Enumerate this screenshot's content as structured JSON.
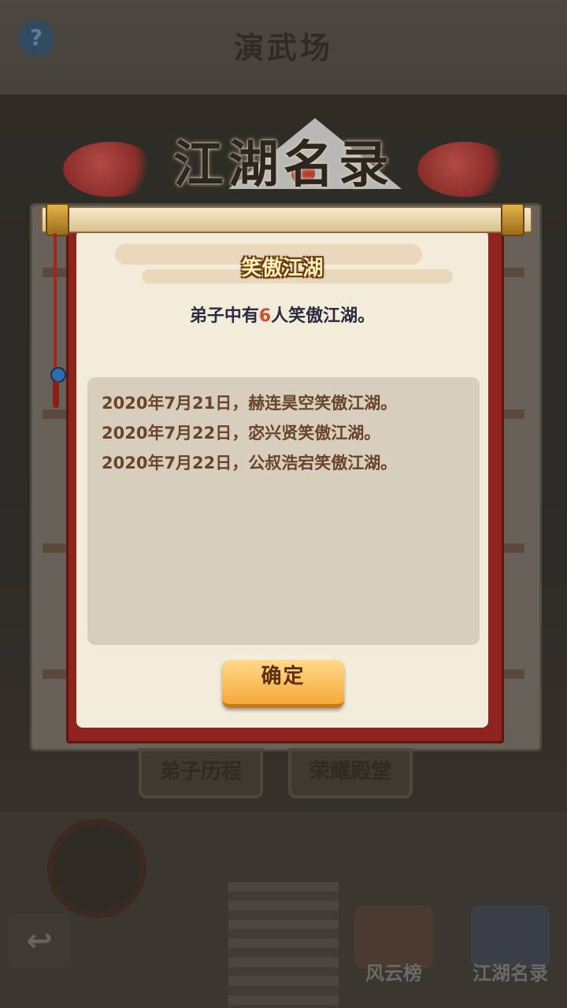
{
  "background": {
    "title": "演武场",
    "help_icon_label": "?",
    "tabs": [
      "弟子历程",
      "荣耀殿堂"
    ],
    "bottom_buttons": [
      "风云榜",
      "江湖名录"
    ],
    "back_icon": "back-arrow-icon"
  },
  "dialog": {
    "banner_title": "江湖名录",
    "section_title": "笑傲江湖",
    "summary": {
      "prefix": "弟子中有",
      "count": "6",
      "suffix": "人笑傲江湖。"
    },
    "entries": [
      "2020年7月21日，赫连昊空笑傲江湖。",
      "2020年7月22日，宓兴贤笑傲江湖。",
      "2020年7月22日，公叔浩宕笑傲江湖。"
    ],
    "confirm_label": "确定"
  },
  "colors": {
    "scroll_red": "#8f231d",
    "paper": "#f3ecdb",
    "count_highlight": "#d44b34",
    "button_orange": "#f7a93a",
    "entry_text": "#6a4428"
  }
}
